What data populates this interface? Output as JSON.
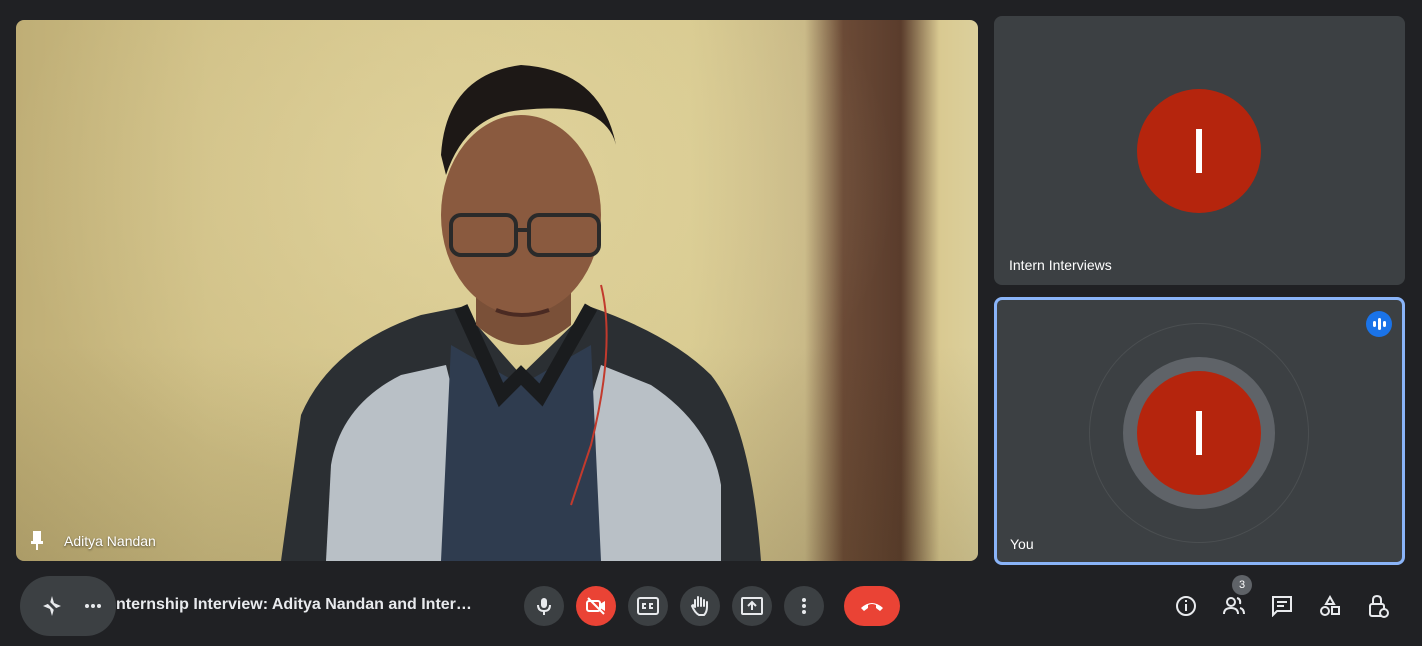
{
  "main_tile": {
    "participant_name": "Aditya Nandan"
  },
  "side_tiles": [
    {
      "name": "Intern Interviews",
      "avatar_letter": "I"
    },
    {
      "name": "You",
      "avatar_letter": "I",
      "speaking": true
    }
  ],
  "bottom_bar": {
    "meeting_title": "nternship Interview: Aditya Nandan and Inter…",
    "participants_count": "3"
  },
  "colors": {
    "background": "#202124",
    "tile": "#3c4043",
    "avatar": "#b5250d",
    "danger": "#ea4335",
    "active_border": "#8ab4f8",
    "speaking_badge": "#1a73e8"
  },
  "icons": [
    "pin-icon",
    "sparkle-effects-icon",
    "more-dots-icon",
    "mic-icon",
    "camera-off-icon",
    "captions-icon",
    "raise-hand-icon",
    "present-screen-icon",
    "more-options-icon",
    "hangup-icon",
    "info-icon",
    "people-icon",
    "chat-icon",
    "activities-icon",
    "host-controls-icon",
    "speaking-indicator-icon"
  ]
}
